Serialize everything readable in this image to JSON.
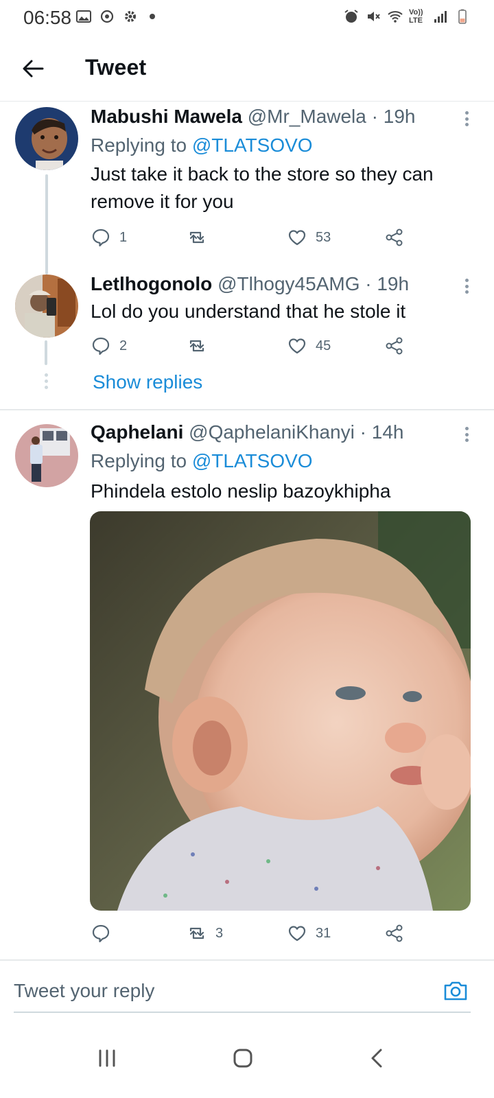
{
  "status_bar": {
    "time": "06:58",
    "left_icons": [
      "image-icon",
      "sync-icon",
      "gear-icon",
      "notification-dot"
    ],
    "right_icons": [
      "alarm-icon",
      "mute-icon",
      "wifi-icon",
      "volte-icon",
      "signal-icon",
      "battery-icon"
    ],
    "volte_label": "Vo)) LTE"
  },
  "header": {
    "title": "Tweet",
    "back_icon": "arrow-left-icon"
  },
  "tweets": [
    {
      "display_name": "Mabushi Mawela",
      "handle": "@Mr_Mawela",
      "separator": "·",
      "time": "19h",
      "replying_prefix": "Replying to",
      "replying_to": "@TLATSOVO",
      "text": "Just take it back to the store so they can remove it for you",
      "replies": "1",
      "retweets": "",
      "likes": "53"
    },
    {
      "display_name": "Letlhogonolo",
      "handle": "@Tlhogy45AMG",
      "separator": "·",
      "time": "19h",
      "text": "Lol do you understand that he stole it",
      "replies": "2",
      "retweets": "",
      "likes": "45"
    },
    {
      "display_name": "Qaphelani",
      "handle": "@QaphelaniKhanyi",
      "separator": "·",
      "time": "14h",
      "replying_prefix": "Replying to",
      "replying_to": "@TLATSOVO",
      "text": "Phindela estolo neslip bazoykhipha",
      "replies": "",
      "retweets": "3",
      "likes": "31"
    }
  ],
  "thread": {
    "show_replies": "Show replies"
  },
  "reply_bar": {
    "placeholder": "Tweet your reply",
    "camera_icon": "camera-icon"
  },
  "nav_bar": {
    "icons": [
      "recent-apps-icon",
      "home-icon",
      "back-icon"
    ]
  },
  "colors": {
    "accent": "#1a8cd8",
    "text_primary": "#0f1419",
    "text_secondary": "#536471",
    "divider": "#e6e9eb"
  }
}
